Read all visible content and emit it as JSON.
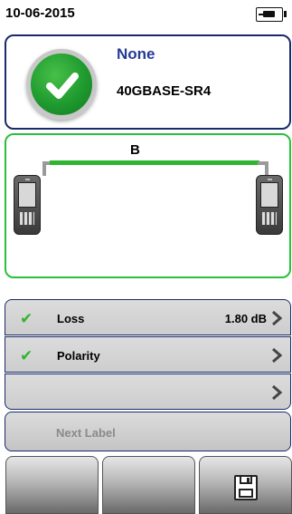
{
  "status": {
    "date": "10-06-2015",
    "power_icon": "battery-plug-icon"
  },
  "result": {
    "status_icon": "check-icon",
    "status_color": "#1f9a2f",
    "name": "None",
    "standard": "40GBASE-SR4"
  },
  "link": {
    "cable_label": "B",
    "cable_color": "#2fb52f",
    "left_device_icon": "tester-device-icon",
    "right_device_icon": "tester-device-icon"
  },
  "measurements": [
    {
      "label": "Loss",
      "value": "1.80 dB",
      "status": "pass"
    },
    {
      "label": "Polarity",
      "value": "",
      "status": "pass"
    },
    {
      "label": "",
      "value": "",
      "status": ""
    }
  ],
  "next_label": {
    "text": "Next Label"
  },
  "softkeys": [
    {
      "label": ""
    },
    {
      "label": ""
    },
    {
      "label": "",
      "icon": "save-icon"
    }
  ]
}
